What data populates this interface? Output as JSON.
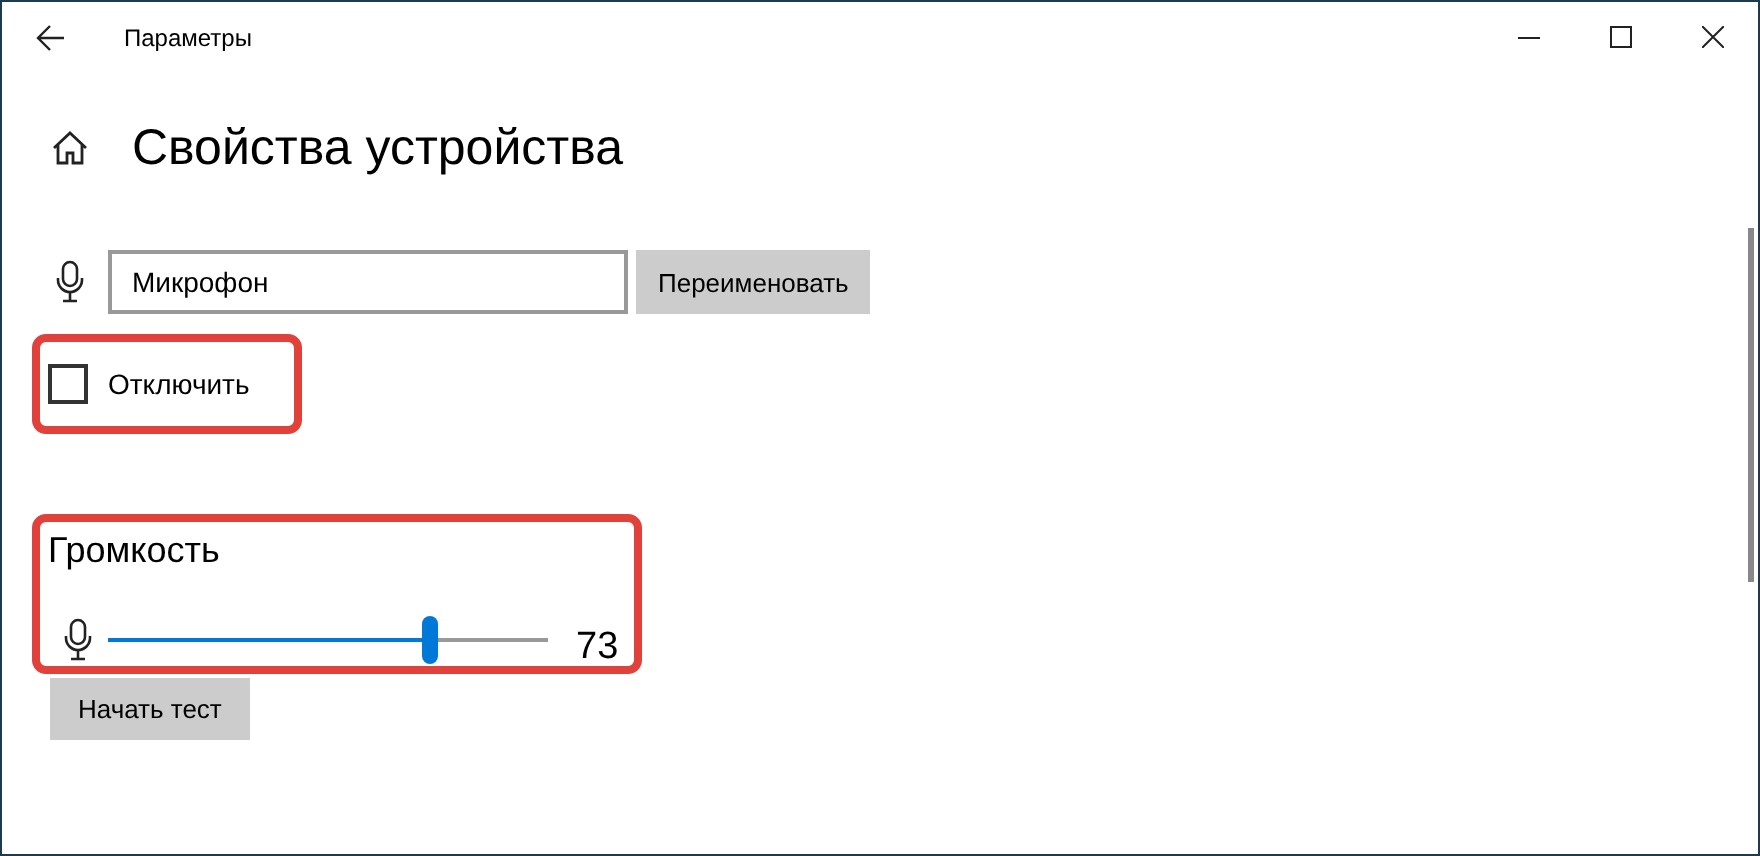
{
  "window": {
    "title": "Параметры"
  },
  "heading": "Свойства устройства",
  "device": {
    "name_value": "Микрофон",
    "rename_button": "Переименовать"
  },
  "mute": {
    "label": "Отключить",
    "checked": false
  },
  "volume": {
    "label": "Громкость",
    "level": 0.73,
    "reading": "73"
  },
  "test_button": "Начать тест"
}
